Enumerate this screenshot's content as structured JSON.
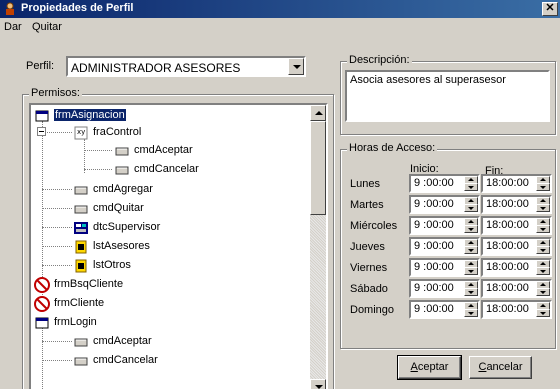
{
  "window": {
    "title": "Propiedades de Perfil",
    "close_glyph": "✕"
  },
  "menu": [
    "Dar",
    "Quitar"
  ],
  "perfil": {
    "label": "Perfil:",
    "value": "ADMINISTRADOR ASESORES"
  },
  "permisos": {
    "title": "Permisos:",
    "tree": [
      {
        "label": "frmAsignacion",
        "icon": "form-icon",
        "selected": true
      },
      {
        "label": "fraControl",
        "icon": "frame-icon",
        "expander": "−"
      },
      {
        "label": "cmdAceptar",
        "icon": "button-icon"
      },
      {
        "label": "cmdCancelar",
        "icon": "button-icon"
      },
      {
        "label": "cmdAgregar",
        "icon": "button-icon"
      },
      {
        "label": "cmdQuitar",
        "icon": "button-icon"
      },
      {
        "label": "dtcSupervisor",
        "icon": "datacombo-icon"
      },
      {
        "label": "lstAsesores",
        "icon": "listbox-icon"
      },
      {
        "label": "lstOtros",
        "icon": "listbox-icon"
      },
      {
        "label": "frmBsqCliente",
        "icon": "denied-icon"
      },
      {
        "label": "frmCliente",
        "icon": "denied-icon"
      },
      {
        "label": "frmLogin",
        "icon": "form-icon"
      },
      {
        "label": "cmdAceptar",
        "icon": "button-icon"
      },
      {
        "label": "cmdCancelar",
        "icon": "button-icon"
      }
    ]
  },
  "descripcion": {
    "title": "Descripción:",
    "value": "Asocia asesores al superasesor"
  },
  "horas": {
    "title": "Horas de Acceso:",
    "col_inicio": "Inicio:",
    "col_fin": "Fin:",
    "days": [
      {
        "day": "Lunes",
        "inicio": "9 :00:00",
        "fin": "18:00:00"
      },
      {
        "day": "Martes",
        "inicio": "9 :00:00",
        "fin": "18:00:00"
      },
      {
        "day": "Miércoles",
        "inicio": "9 :00:00",
        "fin": "18:00:00"
      },
      {
        "day": "Jueves",
        "inicio": "9 :00:00",
        "fin": "18:00:00"
      },
      {
        "day": "Viernes",
        "inicio": "9 :00:00",
        "fin": "18:00:00"
      },
      {
        "day": "Sábado",
        "inicio": "9 :00:00",
        "fin": "18:00:00"
      },
      {
        "day": "Domingo",
        "inicio": "9 :00:00",
        "fin": "18:00:00"
      }
    ]
  },
  "buttons": {
    "aceptar_first": "A",
    "aceptar_rest": "ceptar",
    "cancelar_first": "C",
    "cancelar_rest": "ancelar"
  },
  "colors": {
    "titlebar": "#0a246a",
    "face": "#d4d0c8",
    "selection": "#0a246a"
  }
}
